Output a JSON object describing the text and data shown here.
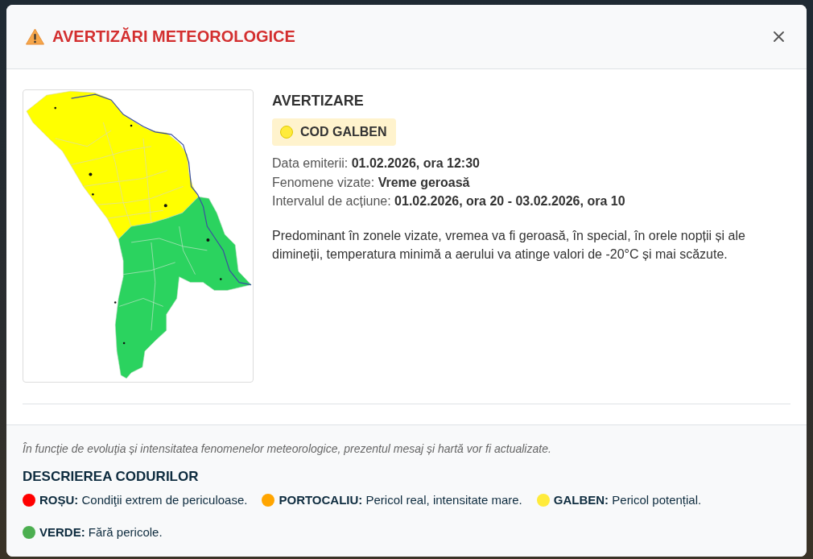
{
  "window": {
    "title": "AVERTIZĂRI METEOROLOGICE"
  },
  "warning": {
    "heading": "AVERTIZARE",
    "badge": {
      "label": "COD GALBEN",
      "color": "#ffeb3b"
    },
    "details": [
      {
        "label": "Data emiterii:",
        "value": "01.02.2026, ora 12:30"
      },
      {
        "label": "Fenomene vizate:",
        "value": "Vreme geroasă"
      },
      {
        "label": "Intervalul de acțiune:",
        "value": "01.02.2026, ora 20 - 03.02.2026, ora 10"
      }
    ],
    "description": "Predominant în zonele vizate, vremea va fi geroasă, în special, în orele nopții și ale dimineții, temperatura minimă a aerului va atinge valori de -20°C și mai scăzute."
  },
  "footer": {
    "note": "În funcţie de evoluţia și intensitatea fenomenelor meteorologice, prezentul mesaj și hartă vor fi actualizate.",
    "legend_title": "DESCRIEREA CODURILOR",
    "legend": [
      {
        "label": "ROȘU:",
        "text": "Condiţii extrem de periculoase.",
        "color": "#ff0000"
      },
      {
        "label": "PORTOCALIU:",
        "text": "Pericol real, intensitate mare.",
        "color": "#ffa500"
      },
      {
        "label": "GALBEN:",
        "text": "Pericol potențial.",
        "color": "#ffeb3b"
      },
      {
        "label": "VERDE:",
        "text": "Fără pericole.",
        "color": "#4caf50"
      }
    ]
  }
}
